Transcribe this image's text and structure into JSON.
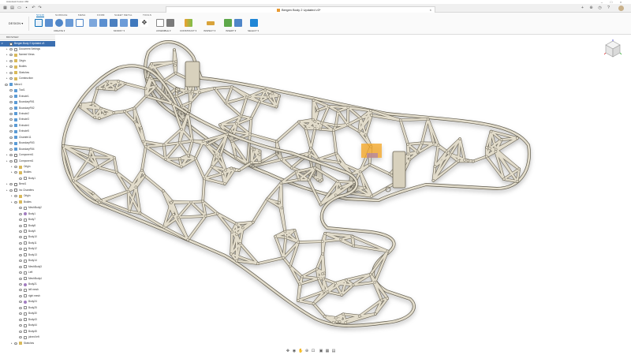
{
  "titlebar": {
    "title": "Autodesk Fusion 360"
  },
  "document": {
    "title": "Bergen Body 2 Updated v3*"
  },
  "ribbon": {
    "workspace": "DESIGN ▾",
    "tabs": [
      "SOLID",
      "SURFACE",
      "MESH",
      "FORM",
      "SHEET METAL",
      "TOOLS"
    ],
    "active_tab": "SOLID",
    "groups": [
      "CREATE ▾",
      "MODIFY ▾",
      "ASSEMBLE ▾",
      "CONSTRUCT ▾",
      "INSPECT ▾",
      "INSERT ▾",
      "SELECT ▾"
    ],
    "accent_color": "#0a6fb8"
  },
  "browser": {
    "header": "BROWSER",
    "root": "Bergen Body 2 Updated v3",
    "nodes": [
      {
        "label": "Document Settings",
        "icon": "doc-icon",
        "indent": 1,
        "arrow": true
      },
      {
        "label": "Named Views",
        "icon": "folder-icon",
        "indent": 1,
        "arrow": true
      },
      {
        "label": "Origin",
        "icon": "folder-icon",
        "indent": 1,
        "arrow": true
      },
      {
        "label": "Bodies",
        "icon": "folder-icon",
        "indent": 1,
        "arrow": true
      },
      {
        "label": "Sketches",
        "icon": "folder-icon",
        "indent": 1,
        "arrow": true
      },
      {
        "label": "Construction",
        "icon": "folder-icon",
        "indent": 1,
        "arrow": true
      },
      {
        "label": "Mirror1",
        "icon": "feat-icon",
        "indent": 0,
        "arrow": false
      },
      {
        "label": "Tool1",
        "icon": "feat-icon",
        "indent": 1,
        "arrow": false
      },
      {
        "label": "Extrude1",
        "icon": "feat-icon",
        "indent": 1,
        "arrow": false
      },
      {
        "label": "BoundaryFill1",
        "icon": "feat-icon",
        "indent": 1,
        "arrow": false
      },
      {
        "label": "BoundaryFill2",
        "icon": "feat-icon",
        "indent": 1,
        "arrow": false
      },
      {
        "label": "Extrude2",
        "icon": "feat-icon",
        "indent": 1,
        "arrow": false
      },
      {
        "label": "Extrude3",
        "icon": "feat-icon",
        "indent": 1,
        "arrow": false
      },
      {
        "label": "Extrude4",
        "icon": "feat-icon",
        "indent": 1,
        "arrow": false
      },
      {
        "label": "Extrude5",
        "icon": "feat-icon",
        "indent": 1,
        "arrow": false
      },
      {
        "label": "Chamfer11",
        "icon": "feat-icon",
        "indent": 1,
        "arrow": false
      },
      {
        "label": "BoundaryFill3",
        "icon": "feat-icon",
        "indent": 1,
        "arrow": false
      },
      {
        "label": "BoundaryFill4",
        "icon": "feat-icon",
        "indent": 1,
        "arrow": false
      },
      {
        "label": "Component1",
        "icon": "comp-icon",
        "indent": 1,
        "arrow": true
      },
      {
        "label": "Component1",
        "icon": "comp-icon",
        "indent": 1,
        "arrow": true
      },
      {
        "label": "Origin",
        "icon": "folder-icon",
        "indent": 2,
        "arrow": true
      },
      {
        "label": "Bodies",
        "icon": "folder-icon",
        "indent": 2,
        "arrow": true
      },
      {
        "label": "Body1",
        "icon": "body-icon",
        "indent": 3,
        "arrow": false
      },
      {
        "label": "Bend1",
        "icon": "comp-icon",
        "indent": 1,
        "arrow": true
      },
      {
        "label": "Inc Chamfers",
        "icon": "comp-icon",
        "indent": 1,
        "arrow": true
      },
      {
        "label": "Origin",
        "icon": "folder-icon",
        "indent": 2,
        "arrow": true
      },
      {
        "label": "Bodies",
        "icon": "folder-icon",
        "indent": 2,
        "arrow": true
      },
      {
        "label": "MeshBody2",
        "icon": "body-icon",
        "indent": 3,
        "arrow": false
      },
      {
        "label": "Body1",
        "icon": "mesh-icon",
        "indent": 3,
        "arrow": false
      },
      {
        "label": "Body7",
        "icon": "body-icon",
        "indent": 3,
        "arrow": false
      },
      {
        "label": "Body8",
        "icon": "body-icon",
        "indent": 3,
        "arrow": false
      },
      {
        "label": "Body9",
        "icon": "body-icon",
        "indent": 3,
        "arrow": false
      },
      {
        "label": "Body10",
        "icon": "body-icon",
        "indent": 3,
        "arrow": false
      },
      {
        "label": "Body11",
        "icon": "body-icon",
        "indent": 3,
        "arrow": false
      },
      {
        "label": "Body12",
        "icon": "body-icon",
        "indent": 3,
        "arrow": false
      },
      {
        "label": "Body13",
        "icon": "body-icon",
        "indent": 3,
        "arrow": false
      },
      {
        "label": "Body14",
        "icon": "body-icon",
        "indent": 3,
        "arrow": false
      },
      {
        "label": "MeshBody3",
        "icon": "body-icon",
        "indent": 3,
        "arrow": false
      },
      {
        "label": "Left",
        "icon": "body-icon",
        "indent": 3,
        "arrow": false
      },
      {
        "label": "MeshBody4",
        "icon": "body-icon",
        "indent": 3,
        "arrow": false
      },
      {
        "label": "Body21",
        "icon": "mesh-icon",
        "indent": 3,
        "arrow": false
      },
      {
        "label": "left mesh",
        "icon": "body-icon",
        "indent": 3,
        "arrow": false
      },
      {
        "label": "right mesh",
        "icon": "body-icon",
        "indent": 3,
        "arrow": false
      },
      {
        "label": "Body24",
        "icon": "mesh-icon",
        "indent": 3,
        "arrow": false
      },
      {
        "label": "Body25",
        "icon": "body-icon",
        "indent": 3,
        "arrow": false
      },
      {
        "label": "Body30",
        "icon": "body-icon",
        "indent": 3,
        "arrow": false
      },
      {
        "label": "Body43",
        "icon": "body-icon",
        "indent": 3,
        "arrow": false
      },
      {
        "label": "Body44",
        "icon": "body-icon",
        "indent": 3,
        "arrow": false
      },
      {
        "label": "Body45",
        "icon": "body-icon",
        "indent": 3,
        "arrow": false
      },
      {
        "label": "joined left",
        "icon": "body-icon",
        "indent": 3,
        "arrow": false
      },
      {
        "label": "Sketches",
        "icon": "folder-icon",
        "indent": 2,
        "arrow": true
      }
    ]
  },
  "viewport": {
    "model_color": "#e2dccb",
    "edge_color": "#6b6556",
    "highlight_color": "#f4a623"
  }
}
